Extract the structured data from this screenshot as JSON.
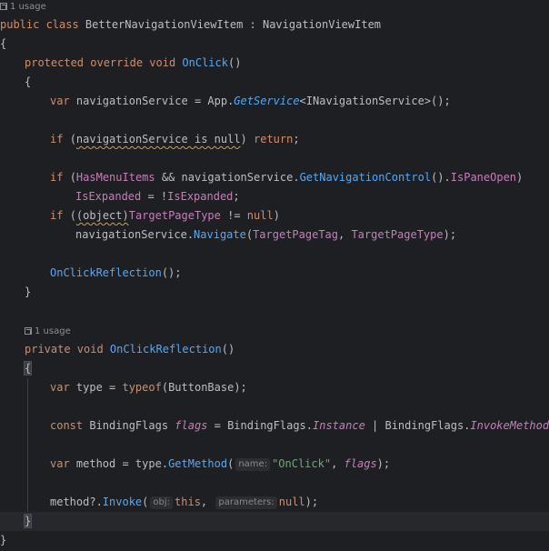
{
  "usage_hint_1": "1 usage",
  "usage_hint_2": "1 usage",
  "hints": {
    "name": "name:",
    "obj": "obj:",
    "parameters": "parameters:"
  },
  "colors": {
    "background": "#1e1f22",
    "keyword": "#cf8e6d",
    "function": "#56a8f5",
    "property": "#c77dbb",
    "string": "#6aab73",
    "text": "#bcbec4",
    "current_line": "#26282e"
  },
  "code": {
    "l1": {
      "a": "public class ",
      "b": "BetterNavigationViewItem : NavigationViewItem"
    },
    "l2": "{",
    "l3": {
      "a": "protected override void ",
      "b": "OnClick",
      "c": "()"
    },
    "l4": "{",
    "l5": {
      "a": "var ",
      "b": "navigationService = App.",
      "c": "GetService",
      "d": "<INavigationService>();"
    },
    "l6": {
      "a": "if ",
      "b": "(",
      "c": "navigationService is null",
      "d": ") ",
      "e": "return",
      "f": ";"
    },
    "l7": {
      "a": "if ",
      "b": "(",
      "c": "HasMenuItems",
      "d": " && navigationService.",
      "e": "GetNavigationControl",
      "f": "().",
      "g": "IsPaneOpen",
      "h": ")"
    },
    "l8": {
      "a": "IsExpanded",
      "b": " = !",
      "c": "IsExpanded",
      "d": ";"
    },
    "l9": {
      "a": "if ",
      "b": "(",
      "c": "(object)",
      "d": "TargetPageType",
      "e": " != ",
      "f": "null",
      "g": ")"
    },
    "l10": {
      "a": "navigationService.",
      "b": "Navigate",
      "c": "(",
      "d": "TargetPageTag",
      "e": ", ",
      "f": "TargetPageType",
      "g": ");"
    },
    "l11": {
      "a": "OnClickReflection",
      "b": "();"
    },
    "l12": "}",
    "l13": {
      "a": "private void ",
      "b": "OnClickReflection",
      "c": "()"
    },
    "l14": "{",
    "l15": {
      "a": "var ",
      "b": "type = ",
      "c": "typeof",
      "d": "(ButtonBase);"
    },
    "l16": {
      "a": "const ",
      "b": "BindingFlags ",
      "c": "flags",
      "d": " = BindingFlags.",
      "e": "Instance",
      "f": " | BindingFlags.",
      "g": "InvokeMethod",
      "h": ";"
    },
    "l17": {
      "a": "var ",
      "b": "method = type.",
      "c": "GetMethod",
      "d": "(",
      "e": "\"OnClick\"",
      "f": ", ",
      "g": "flags",
      "h": ");"
    },
    "l18": {
      "a": "method?.",
      "b": "Invoke",
      "c": "(",
      "d": "this",
      "e": ", ",
      "f": "null",
      "g": ");"
    },
    "l19": "}",
    "l20": "}"
  }
}
